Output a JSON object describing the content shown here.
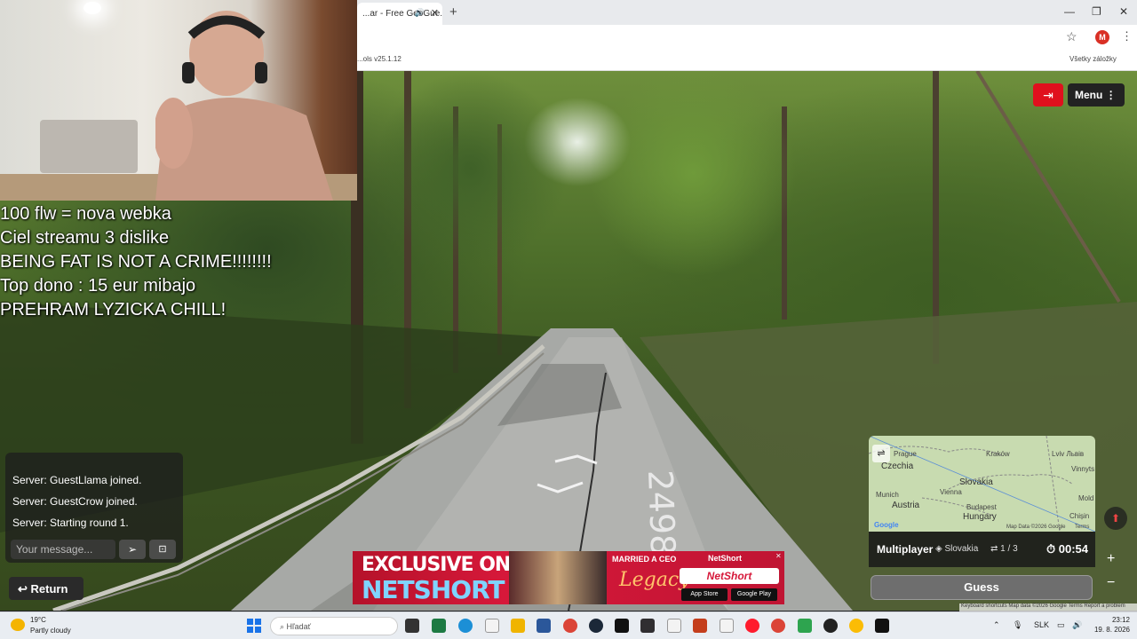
{
  "browser": {
    "tab_title": "...ar - Free GeoGue...",
    "tab_close": "✕",
    "tab_audio_icon": "🔊",
    "new_tab": "+",
    "window_controls": [
      "—",
      "❐",
      "✕"
    ],
    "star_icon": "☆",
    "profile_initial": "M",
    "menu_icon": "⋮",
    "bookmark_left": "...ols v25.1.12",
    "bookmark_right": "Všetky záložky"
  },
  "streetview": {
    "road_marking": "2498",
    "exit_icon": "⇥",
    "menu_label": "Menu ⋮"
  },
  "overlay": {
    "lines": [
      "100 flw = nova webka",
      "Ciel streamu 3 dislike",
      "BEING FAT IS NOT A CRIME!!!!!!!!",
      "Top dono : 15 eur mibajo",
      "PREHRAM LYZICKA CHILL!"
    ]
  },
  "chat": {
    "messages": [
      "Server: GuestLlama joined.",
      "Server: GuestCrow joined.",
      "Server: Starting round 1."
    ],
    "placeholder": "Your message...",
    "send_icon": "➢",
    "more_icon": "⊡",
    "return_label": "↩  Return"
  },
  "ad": {
    "line1": "EXCLUSIVE ON",
    "line2": "NETSHORT",
    "married": "MARRIED A CEO",
    "legacy": "Legacy",
    "brand_small": "NetShort",
    "brand_pill": "NetShort",
    "store1": "App Store",
    "store2": "Google Play",
    "close": "✕"
  },
  "minimap": {
    "labels": {
      "czechia": "Czechia",
      "slovakia": "Slovakia",
      "austria": "Austria",
      "hungary": "Hungary",
      "krakow": "Kraków",
      "lviv": "Lviv\nЛьвів",
      "vienna": "Vienna",
      "budapest": "Budapest",
      "prague": "Prague",
      "munich": "Munich",
      "chisinau": "Chișin",
      "mold": "Mold",
      "vinnytsia": "Vinnyts\nВінниц"
    },
    "pin_icon": "⇌",
    "google": "Google",
    "map_data": "Map Data ©2026 Google",
    "terms": "Terms"
  },
  "status": {
    "mode": "Multiplayer",
    "country": "Slovakia",
    "round": "1 / 3",
    "timer": "00:54",
    "guess_label": "Guess",
    "zoom_in": "+",
    "zoom_out": "−",
    "compass_icon": "⬆",
    "credits": "Keyboard shortcuts   Map data ©2026 Google   Terms   Report a problem"
  },
  "taskbar": {
    "temp": "19°C",
    "weather": "Partly cloudy",
    "search_placeholder": "Hľadať",
    "lang": "SLK",
    "time": "23:12",
    "date": "19. 8. 2026"
  }
}
